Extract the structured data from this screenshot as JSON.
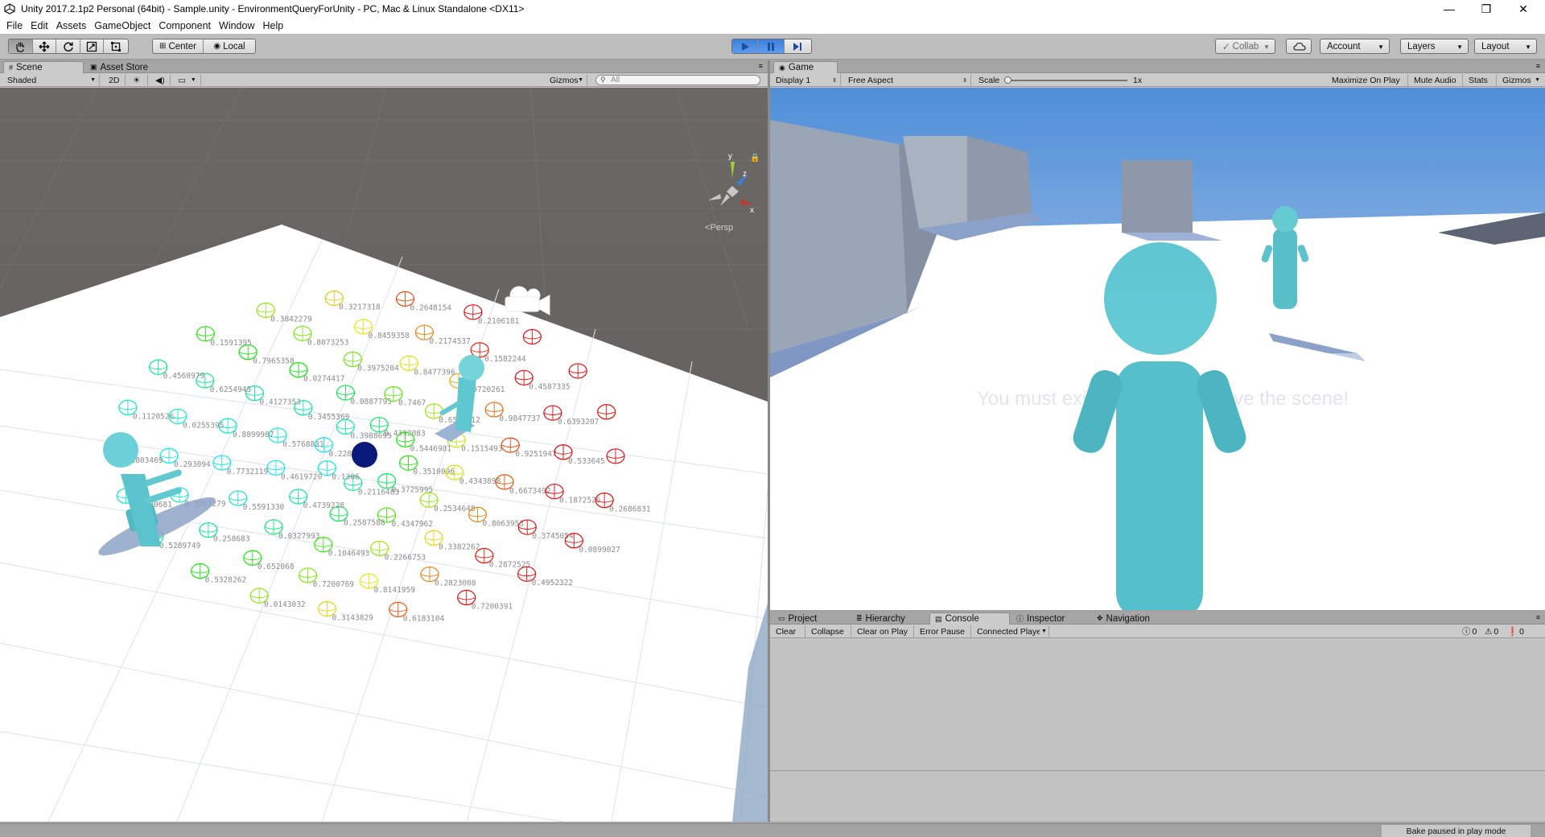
{
  "window": {
    "title": "Unity 2017.2.1p2 Personal (64bit) - Sample.unity - EnvironmentQueryForUnity - PC, Mac & Linux Standalone <DX11>",
    "minimize_glyph": "—",
    "maximize_glyph": "❐",
    "close_glyph": "✕"
  },
  "menu": [
    "File",
    "Edit",
    "Assets",
    "GameObject",
    "Component",
    "Window",
    "Help"
  ],
  "toolbar": {
    "pivot": "Center",
    "space": "Local",
    "collab": "Collab",
    "account": "Account",
    "layers": "Layers",
    "layout": "Layout",
    "play_state": "playing-paused"
  },
  "scene_panel": {
    "tabs": [
      "Scene",
      "Asset Store"
    ],
    "shading": "Shaded",
    "mode_2d": "2D",
    "gizmos": "Gizmos",
    "search_placeholder": "All",
    "projection": "Persp",
    "gizmo_axes": [
      "y",
      "z",
      "x"
    ]
  },
  "game_panel": {
    "tab": "Game",
    "display": "Display 1",
    "aspect": "Free Aspect",
    "scale_label": "Scale",
    "scale_value": "1x",
    "maximize_on_play": "Maximize On Play",
    "mute_audio": "Mute Audio",
    "stats": "Stats",
    "gizmos": "Gizmos",
    "overlay_message": "You must exit play mode to save the scene!"
  },
  "bottom_panel": {
    "tabs": [
      "Project",
      "Hierarchy",
      "Console",
      "Inspector",
      "Navigation"
    ],
    "active_tab": "Console",
    "buttons": [
      "Clear",
      "Collapse",
      "Clear on Play",
      "Error Pause",
      "Connected Player"
    ],
    "counts": {
      "logs": "0",
      "warnings": "0",
      "errors": "0"
    }
  },
  "status": {
    "message": "Bake paused in play mode"
  },
  "scene_score_labels": [
    "0.3510096",
    "0.3725995",
    "0.2116483",
    "0.1306",
    "0.2288597",
    "0.3988695",
    "0.4392083",
    "0.5446981",
    "0.4343898",
    "0.2534648",
    "0.4347962",
    "0.2587588",
    "0.4739228",
    "0.4619720",
    "0.5768831",
    "0.3455369",
    "0.0887795",
    "0.7467",
    "0.6540712",
    "0.1515493",
    "0.6673492",
    "0.8063953",
    "0.3382262",
    "0.2266753",
    "0.1046493",
    "0.0327993",
    "0.5591330",
    "0.7732119",
    "0.8899987",
    "0.4127353",
    "0.0274417",
    "0.3975204",
    "0.8477396",
    "0.9720261",
    "0.9847737",
    "0.9251947",
    "0.1872526",
    "0.3745054",
    "0.2872525",
    "0.2823008",
    "0.8141959",
    "0.7200769",
    "0.652068",
    "0.258683",
    "0.3903279",
    "0.293094",
    "0.0255395",
    "0.6254945",
    "0.7965358",
    "0.8073253",
    "0.8459358",
    "0.2174537",
    "0.1582244",
    "0.4587335",
    "0.6393207",
    "0.533645",
    "0.2686831",
    "0.0899027",
    "0.4952322",
    "0.7200391",
    "0.6183104",
    "0.3143829",
    "0.0143032",
    "0.5328262",
    "0.5289749",
    "0.4620681",
    "0.3803469",
    "0.1120526",
    "0.4560979",
    "0.1591395",
    "0.3842279",
    "0.3217318",
    "0.2648154",
    "0.2106181"
  ]
}
